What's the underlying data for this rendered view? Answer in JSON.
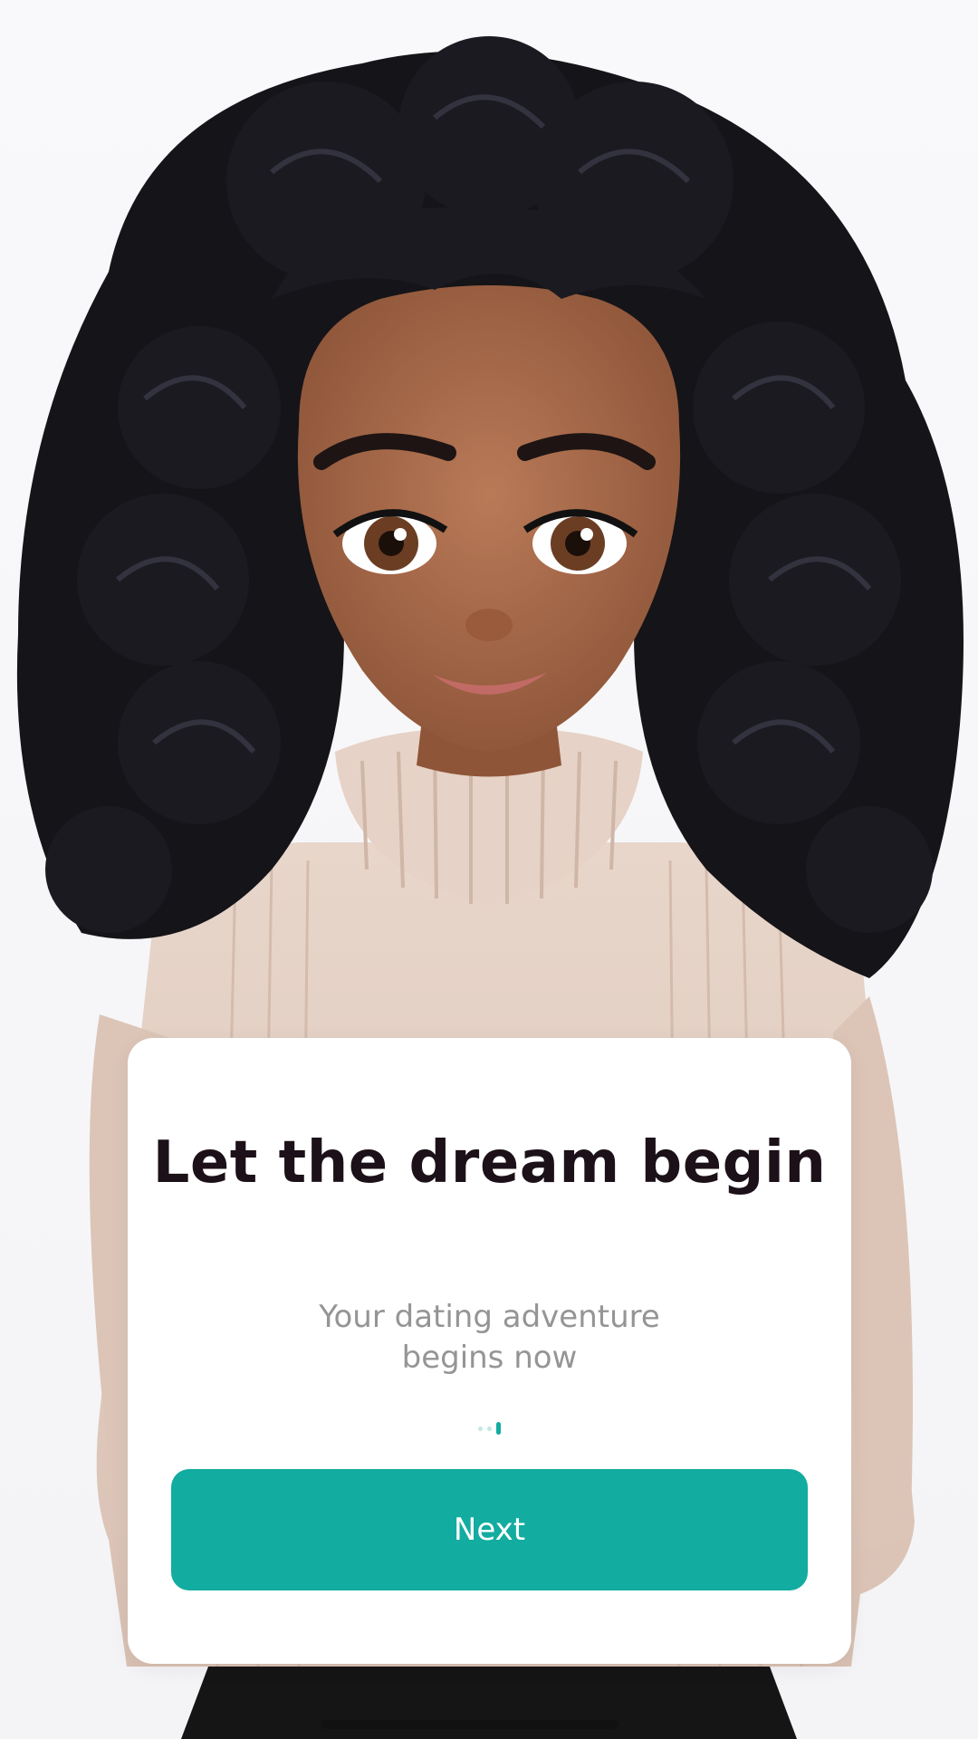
{
  "onboarding": {
    "title": "Let the dream begin",
    "subtitle": "Your dating adventure begins now",
    "next_label": "Next",
    "page_indicator": {
      "total": 3,
      "current": 3
    }
  },
  "colors": {
    "accent": "#12aca0",
    "title": "#1c1118",
    "subtitle": "#959595",
    "card": "#ffffff",
    "background": "#f7f7f8"
  },
  "illustration": {
    "subject": "cartoon girl with curly black hair in a beige ribbed turtleneck sweater"
  }
}
